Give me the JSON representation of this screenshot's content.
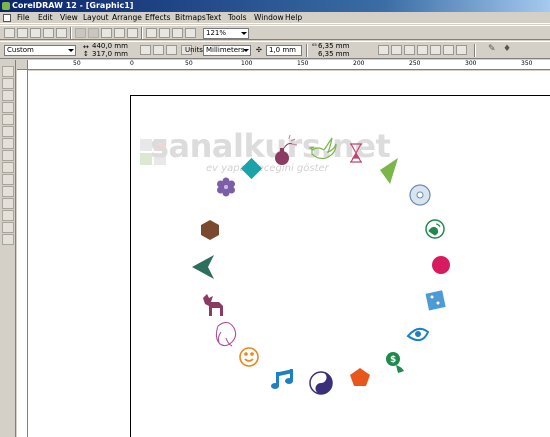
{
  "window": {
    "title": "CorelDRAW 12 - [Graphic1]"
  },
  "menu": [
    "File",
    "Edit",
    "View",
    "Layout",
    "Arrange",
    "Effects",
    "Bitmaps",
    "Text",
    "Tools",
    "Window",
    "Help"
  ],
  "toolbar": {
    "zoom": "121%"
  },
  "property_bar": {
    "page_preset": "Custom",
    "width": "440,0 mm",
    "height": "317,0 mm",
    "units_label": "Units:",
    "units_value": "Millimeters",
    "nudge": "1,0 mm",
    "dup_x": "6,35 mm",
    "dup_y": "6,35 mm"
  },
  "ruler": {
    "labels": [
      "50",
      "0",
      "50",
      "100",
      "150",
      "200",
      "250",
      "300",
      "350"
    ]
  },
  "watermark": {
    "brand": "sanalkurs.net",
    "tagline": "ev yapabileceğini göster"
  },
  "shapes": [
    {
      "name": "bomb-shape",
      "color": "#8b3a62"
    },
    {
      "name": "dove-shape",
      "color": "#7ab648"
    },
    {
      "name": "hourglass-shape",
      "color": "#c2436f"
    },
    {
      "name": "triangle-shape",
      "color": "#7ab648"
    },
    {
      "name": "cd-shape",
      "color": "#6a8bb3"
    },
    {
      "name": "globe-shape",
      "color": "#1e8a4c"
    },
    {
      "name": "circle-shape",
      "color": "#d81b60"
    },
    {
      "name": "cube-shape",
      "color": "#4d9bd5"
    },
    {
      "name": "eye-shape",
      "color": "#1f7fc1"
    },
    {
      "name": "money-hand-shape",
      "color": "#1e8a4c"
    },
    {
      "name": "pentagon-shape",
      "color": "#e8561c"
    },
    {
      "name": "yin-yang-shape",
      "color": "#3a2f7a"
    },
    {
      "name": "music-note-shape",
      "color": "#1f7fc1"
    },
    {
      "name": "smiley-shape",
      "color": "#e8891c"
    },
    {
      "name": "elephant-shape",
      "color": "#b04fa0"
    },
    {
      "name": "moose-shape",
      "color": "#8b3a62"
    },
    {
      "name": "arrowhead-shape",
      "color": "#2d6e5e"
    },
    {
      "name": "hexagon-shape",
      "color": "#7b4a2e"
    },
    {
      "name": "flower-shape",
      "color": "#7a5fa8"
    },
    {
      "name": "diamond-shape",
      "color": "#1aa3a8"
    }
  ]
}
